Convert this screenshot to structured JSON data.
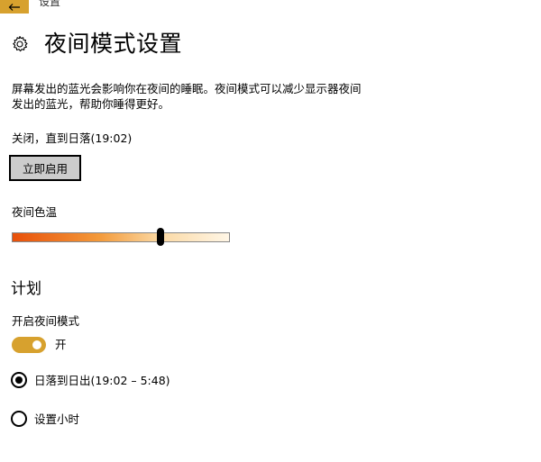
{
  "window": {
    "title": "设置"
  },
  "header": {
    "title": "夜间模式设置",
    "icon": "gear-icon"
  },
  "description": "屏幕发出的蓝光会影响你在夜间的睡眠。夜间模式可以减少显示器夜间发出的蓝光，帮助你睡得更好。",
  "status_text": "关闭，直到日落(19:02)",
  "enable_button": {
    "label": "立即启用"
  },
  "color_temperature": {
    "label": "夜间色温",
    "value_fraction": 0.68
  },
  "schedule": {
    "title": "计划",
    "toggle_label": "开启夜间模式",
    "toggle_state_text": "开",
    "toggle_on": true,
    "options": [
      {
        "label": "日落到日出(19:02 – 5:48)",
        "selected": true
      },
      {
        "label": "设置小时",
        "selected": false
      }
    ]
  },
  "colors": {
    "accent": "#d7a12e",
    "button_bg": "#cccccc",
    "gradient_start": "#e8500a",
    "gradient_end": "#fff6e6"
  }
}
